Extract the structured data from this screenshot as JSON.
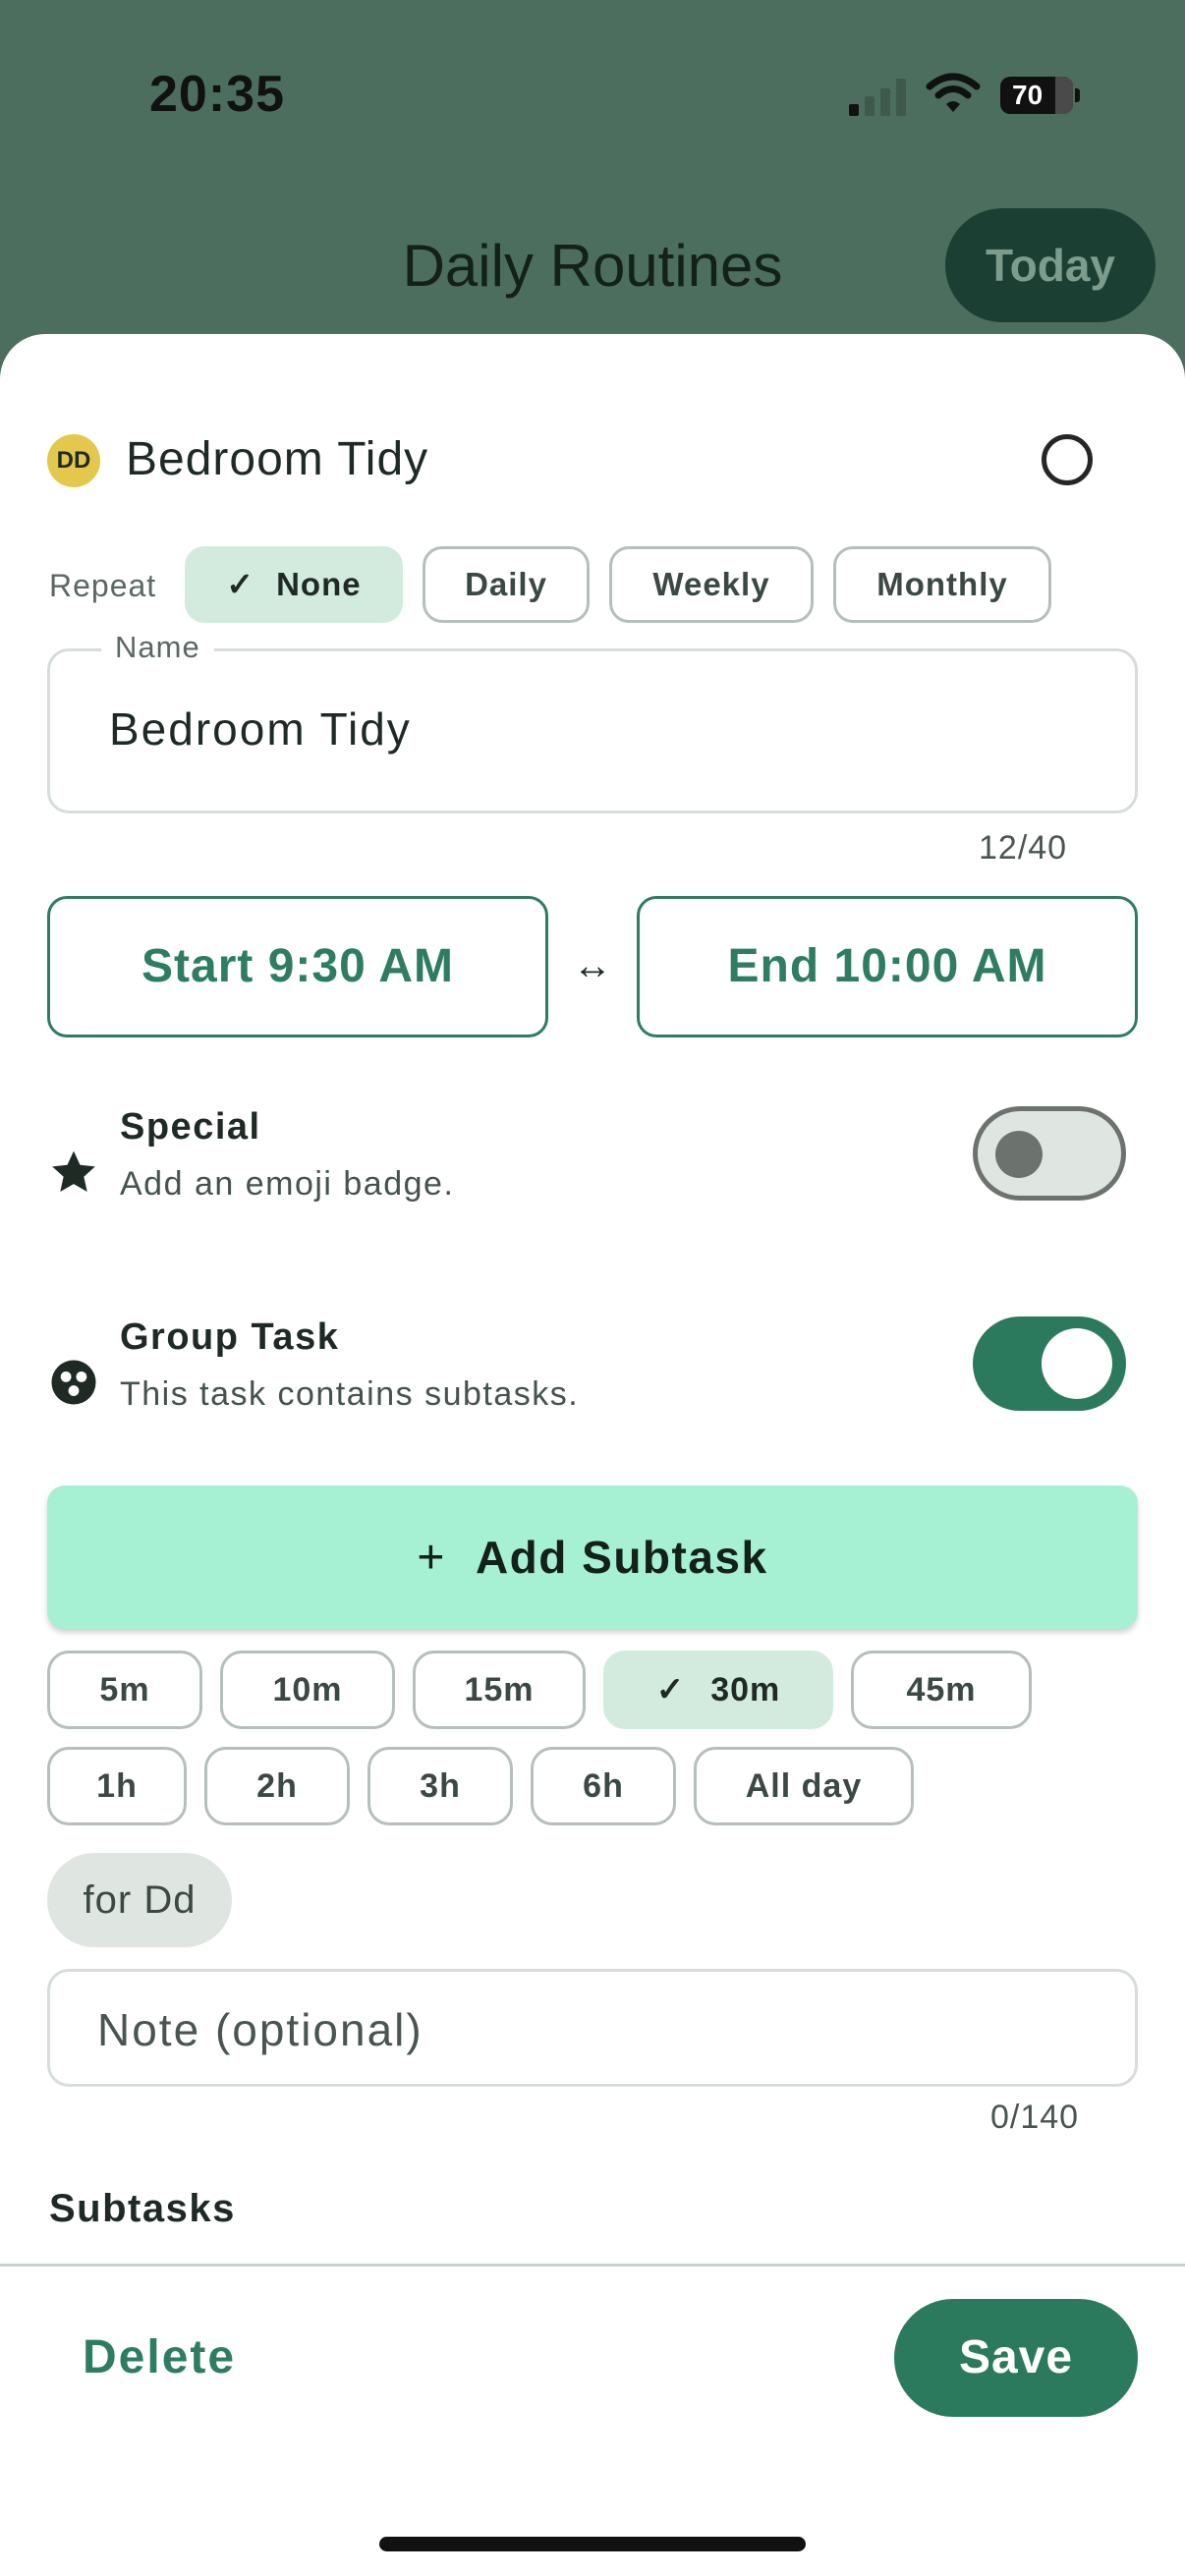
{
  "status_bar": {
    "time": "20:35",
    "battery": "70"
  },
  "header": {
    "title": "Daily Routines",
    "today_label": "Today"
  },
  "task": {
    "avatar_initials": "DD",
    "avatar_color": "#e3c84d",
    "title": "Bedroom Tidy"
  },
  "repeat": {
    "label": "Repeat",
    "options": [
      "None",
      "Daily",
      "Weekly",
      "Monthly"
    ],
    "selected": "None"
  },
  "name_field": {
    "label": "Name",
    "value": "Bedroom Tidy",
    "counter": "12/40"
  },
  "time_range": {
    "start_label": "Start 9:30 AM",
    "end_label": "End 10:00 AM",
    "swap_icon": "↔"
  },
  "special": {
    "title": "Special",
    "subtitle": "Add an emoji badge.",
    "icon": "star-icon",
    "enabled": false
  },
  "group_task": {
    "title": "Group Task",
    "subtitle": "This task contains subtasks.",
    "icon": "group-icon",
    "enabled": true
  },
  "add_subtask": {
    "label": "Add Subtask",
    "icon": "+"
  },
  "durations": {
    "row1": [
      "5m",
      "10m",
      "15m",
      "30m",
      "45m"
    ],
    "row2": [
      "1h",
      "2h",
      "3h",
      "6h",
      "All day"
    ],
    "selected": "30m"
  },
  "assignee_chip": "for Dd",
  "note_field": {
    "placeholder": "Note (optional)",
    "counter": "0/140"
  },
  "subtasks": {
    "heading": "Subtasks"
  },
  "footer": {
    "delete_label": "Delete",
    "save_label": "Save"
  },
  "colors": {
    "accent": "#2c7a5e",
    "header_bg": "#4c6e5e",
    "add_subtask_bg": "#a6f0d4",
    "chip_selected_bg": "#d3ebdf"
  }
}
